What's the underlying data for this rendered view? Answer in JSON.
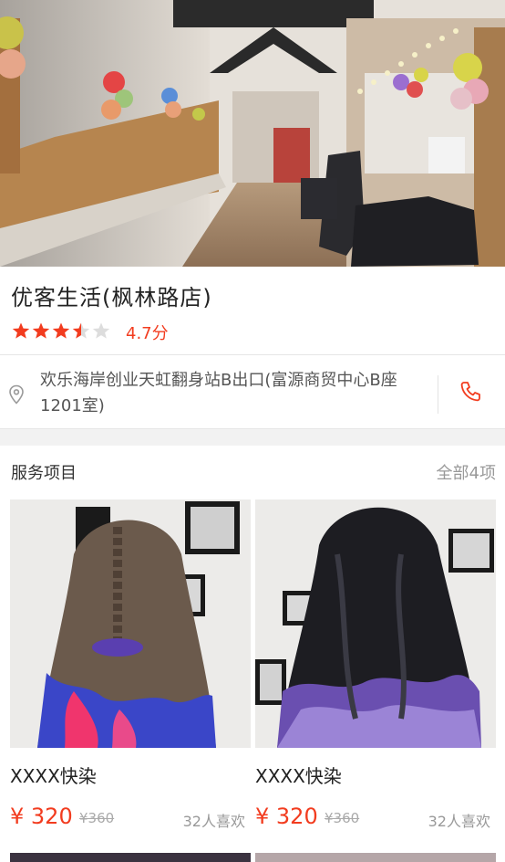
{
  "shop": {
    "name": "优客生活(枫林路店)",
    "rating_value": 3.5,
    "rating_max": 5,
    "score_text": "4.7分",
    "address": "欢乐海岸创业天虹翻身站B出口(富源商贸中心B座1201室)"
  },
  "services": {
    "title": "服务项目",
    "all_label": "全部4项",
    "items": [
      {
        "name": "XXXX快染",
        "price": "¥ 320",
        "original_price": "¥360",
        "likes": "32人喜欢",
        "hair_colors": [
          "#6b5a4c",
          "#3a46c8",
          "#f0356d"
        ]
      },
      {
        "name": "XXXX快染",
        "price": "¥ 320",
        "original_price": "¥360",
        "likes": "32人喜欢",
        "hair_colors": [
          "#1d1d22",
          "#6a4fb0",
          "#9b84d6"
        ]
      }
    ]
  },
  "colors": {
    "accent": "#f23c1f",
    "star_empty": "#dddddd"
  },
  "icons": {
    "location": "location-pin-icon",
    "phone": "phone-icon"
  }
}
